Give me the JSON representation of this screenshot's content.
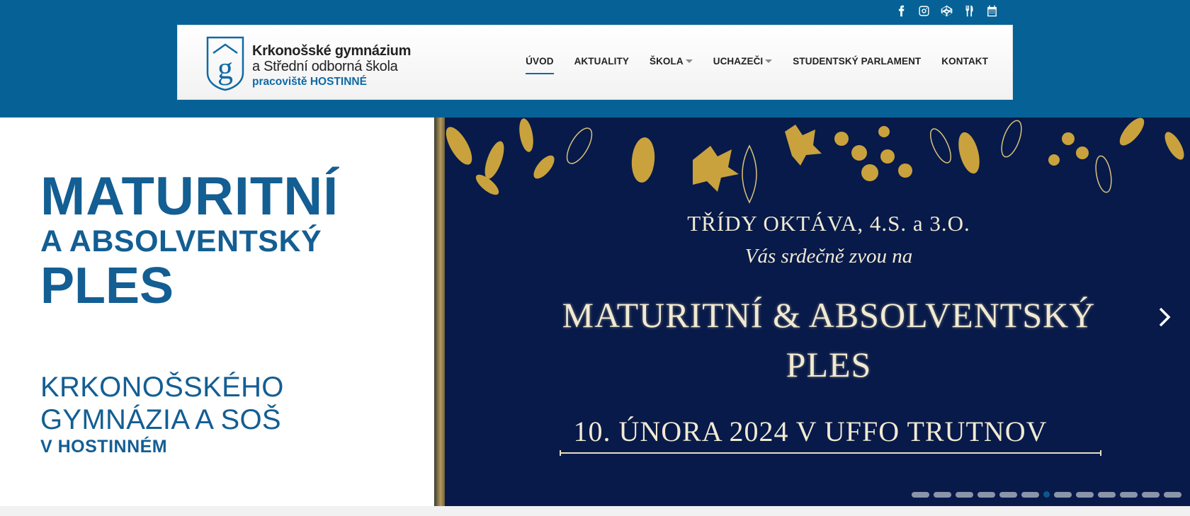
{
  "social": [
    {
      "icon": "facebook-icon"
    },
    {
      "icon": "instagram-icon"
    },
    {
      "icon": "codepen-icon"
    },
    {
      "icon": "cutlery-icon"
    },
    {
      "icon": "calendar-icon"
    }
  ],
  "logo": {
    "line1": "Krkonošské gymnázium",
    "line2": "a Střední odborná škola",
    "line3": "pracoviště HOSTINNÉ",
    "mark_letter": "g"
  },
  "menu": [
    {
      "label": "ÚVOD",
      "active": true,
      "dropdown": false
    },
    {
      "label": "AKTUALITY",
      "active": false,
      "dropdown": false
    },
    {
      "label": "ŠKOLA",
      "active": false,
      "dropdown": true
    },
    {
      "label": "UCHAZEČI",
      "active": false,
      "dropdown": true
    },
    {
      "label": "STUDENTSKÝ PARLAMENT",
      "active": false,
      "dropdown": false
    },
    {
      "label": "KONTAKT",
      "active": false,
      "dropdown": false
    }
  ],
  "hero": {
    "title_line1": "MATURITNÍ",
    "title_line2": "A ABSOLVENTSKÝ",
    "title_line3": "PLES",
    "subtitle_line1": "KRKONOŠSKÉHO",
    "subtitle_line2": "GYMNÁZIA A SOŠ",
    "subtitle_line3": "V HOSTINNÉM"
  },
  "slide": {
    "line1": "TŘÍDY OKTÁVA, 4.S. a 3.O.",
    "line2": "Vás srdečně zvou na",
    "line3": "MATURITNÍ & ABSOLVENTSKÝ",
    "line4": "PLES",
    "line5": "10. ÚNORA 2024 V UFFO TRUTNOV"
  },
  "slider": {
    "total": 13,
    "active_index": 6
  },
  "colors": {
    "brand_blue": "#066296",
    "heading_blue": "#135e93",
    "slide_bg": "#081a4a",
    "gold": "#c9a23e"
  }
}
